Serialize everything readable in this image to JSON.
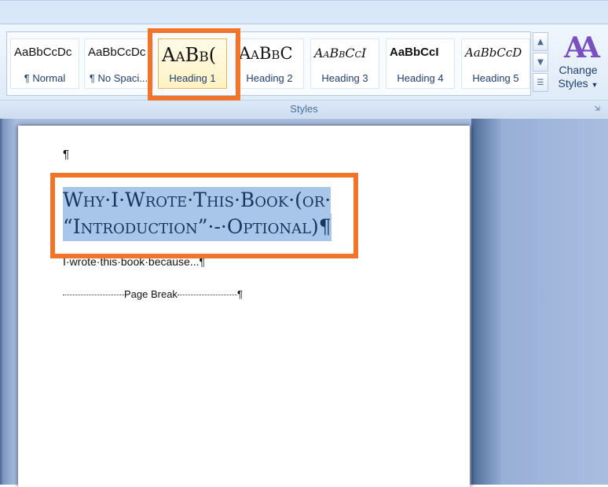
{
  "ribbon": {
    "styles": [
      {
        "sample": "AaBbCcDc",
        "name": "¶ Normal"
      },
      {
        "sample": "AaBbCcDc",
        "name": "¶ No Spaci..."
      },
      {
        "sample": "AaBb(",
        "name": "Heading 1"
      },
      {
        "sample": "AaBbC",
        "name": "Heading 2"
      },
      {
        "sample": "AaBbCcI",
        "name": "Heading 3"
      },
      {
        "sample": "AaBbCcI",
        "name": "Heading 4"
      },
      {
        "sample": "AaBbCcD",
        "name": "Heading 5"
      }
    ],
    "change_styles_line1": "Change",
    "change_styles_line2": "Styles",
    "group_label": "Styles"
  },
  "document": {
    "empty_paragraph": "¶",
    "heading_line1": "Why·I·Wrote·This·Book·(or·",
    "heading_line2": "“Introduction”·-·Optional)¶",
    "body_text": "I·wrote·this·book·because...¶",
    "page_break_label": "Page Break",
    "page_break_mark": "¶"
  },
  "colors": {
    "highlight_box": "#f0742a",
    "heading_text": "#17365d",
    "selection": "#a8c6ea"
  }
}
